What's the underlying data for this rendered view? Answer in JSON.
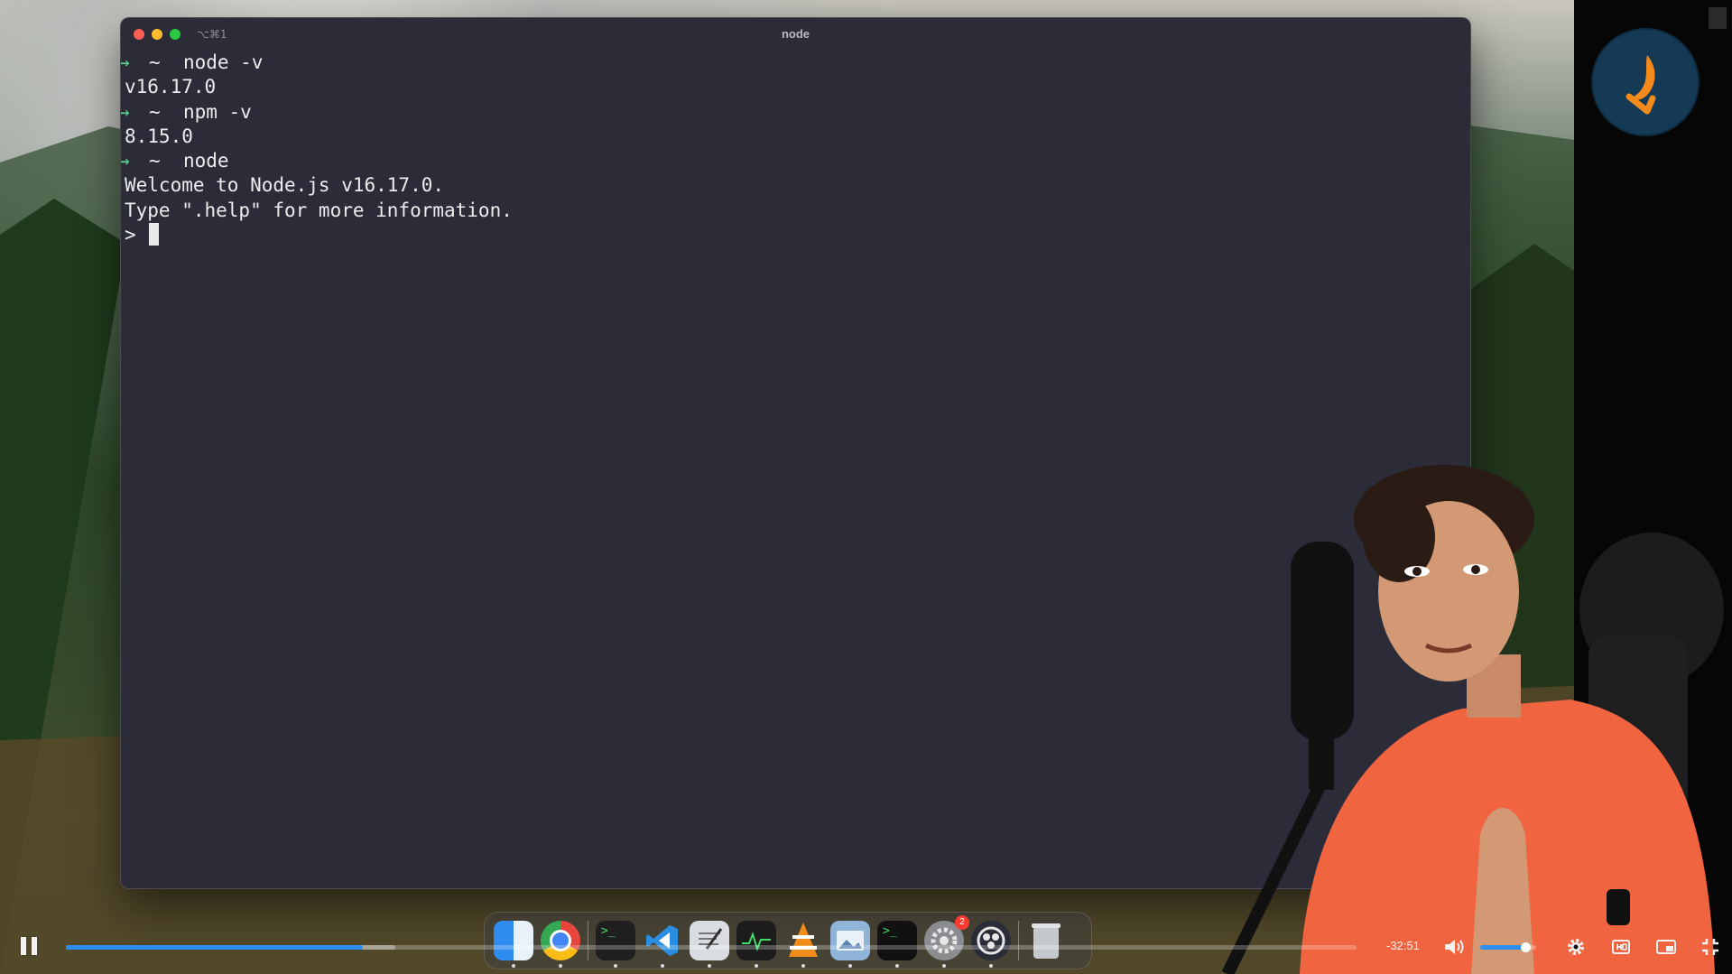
{
  "terminal": {
    "shortcut": "⌥⌘1",
    "title": "node",
    "lines": [
      {
        "kind": "prompt",
        "arrow": "→",
        "tilde": "~",
        "cmd": "node -v"
      },
      {
        "kind": "output",
        "text": "v16.17.0"
      },
      {
        "kind": "prompt",
        "arrow": "→",
        "tilde": "~",
        "cmd": "npm -v"
      },
      {
        "kind": "output",
        "text": "8.15.0"
      },
      {
        "kind": "prompt",
        "arrow": "→",
        "tilde": "~",
        "cmd": "node"
      },
      {
        "kind": "output",
        "text": "Welcome to Node.js v16.17.0."
      },
      {
        "kind": "output",
        "text": "Type \".help\" for more information."
      }
    ],
    "repl_prompt": ">"
  },
  "dock": {
    "apps": [
      {
        "name": "finder-icon",
        "color": "#2f8cf0",
        "running": true
      },
      {
        "name": "chrome-icon",
        "color": "#e8453c",
        "running": true
      },
      {
        "name": "separator"
      },
      {
        "name": "terminal-icon",
        "color": "#1f1f1f",
        "running": true
      },
      {
        "name": "vscode-icon",
        "color": "#2a7fd4",
        "running": true
      },
      {
        "name": "textedit-icon",
        "color": "#d9dde2",
        "running": true
      },
      {
        "name": "activity-monitor-icon",
        "color": "#1c1c1c",
        "running": true
      },
      {
        "name": "vlc-icon",
        "color": "#f08c1a",
        "running": true
      },
      {
        "name": "preview-icon",
        "color": "#8fb4d8",
        "running": true
      },
      {
        "name": "iterm-icon",
        "color": "#111111",
        "running": true
      },
      {
        "name": "system-settings-icon",
        "color": "#8a8c90",
        "running": true,
        "badge": "2"
      },
      {
        "name": "obs-icon",
        "color": "#2a2c38",
        "running": true
      },
      {
        "name": "separator"
      },
      {
        "name": "trash-icon",
        "color": "#b8bcc2",
        "running": false
      }
    ]
  },
  "player": {
    "time_remaining": "-32:51",
    "progress": 0.23,
    "buffered": 0.255,
    "volume": 0.8,
    "accent": "#2b8ef0"
  }
}
